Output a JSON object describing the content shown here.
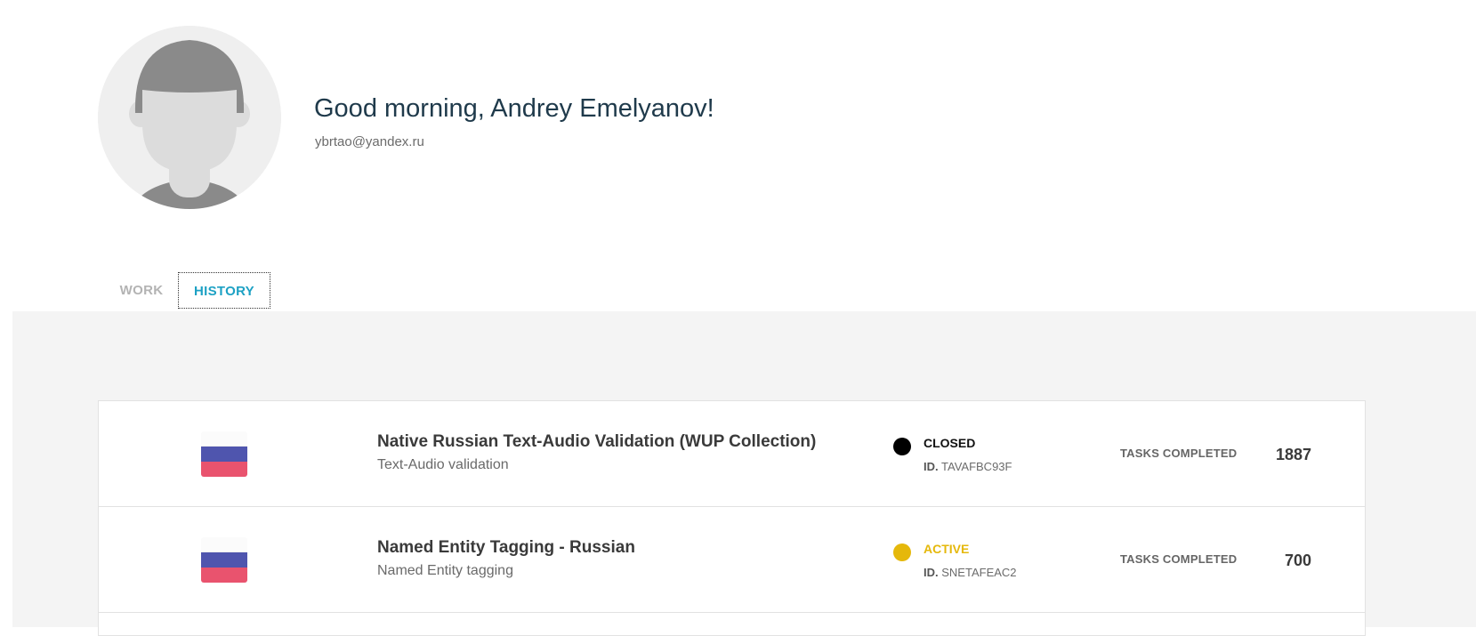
{
  "profile": {
    "greeting": "Good morning, Andrey Emelyanov!",
    "email": "ybrtao@yandex.ru"
  },
  "tabs": [
    {
      "label": "WORK",
      "active": false
    },
    {
      "label": "HISTORY",
      "active": true
    }
  ],
  "colors": {
    "accent": "#1da1c4",
    "closed": "#000000",
    "active": "#e5b80b",
    "flag_white": "#fbfbfb",
    "flag_blue": "#4f55ae",
    "flag_red": "#e9536e"
  },
  "projects": [
    {
      "flag_icon": "russia-flag-icon",
      "title": "Native Russian Text-Audio Validation (WUP Collection)",
      "type": "Text-Audio validation",
      "status": "CLOSED",
      "id_label": "ID.",
      "id": "TAVAFBC93F",
      "tasks_label": "TASKS COMPLETED",
      "tasks_count": "1887"
    },
    {
      "flag_icon": "russia-flag-icon",
      "title": "Named Entity Tagging - Russian",
      "type": "Named Entity tagging",
      "status": "ACTIVE",
      "id_label": "ID.",
      "id": "SNETAFEAC2",
      "tasks_label": "TASKS COMPLETED",
      "tasks_count": "700"
    }
  ]
}
